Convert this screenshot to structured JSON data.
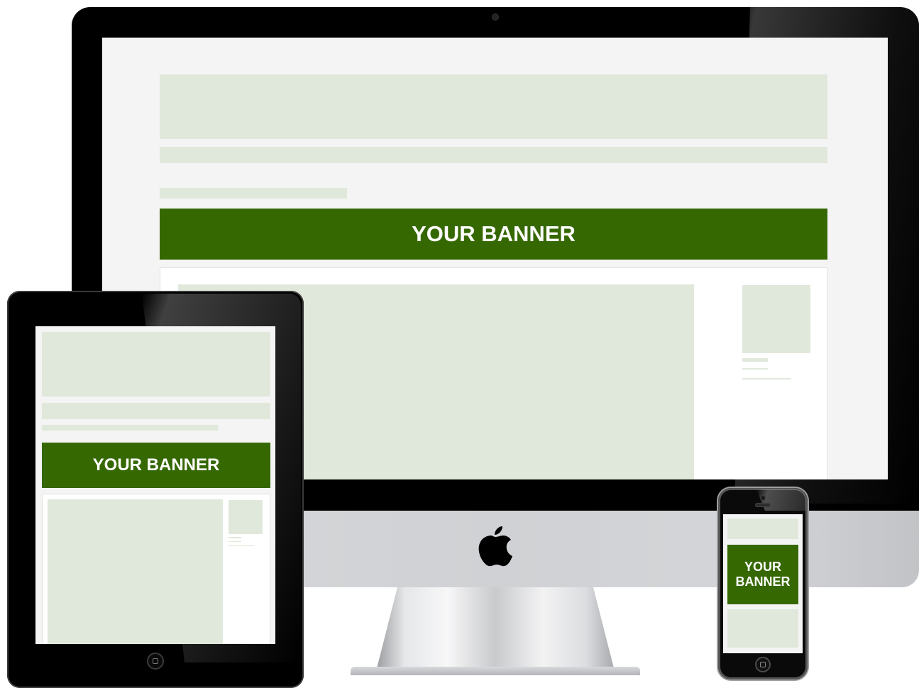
{
  "desktop": {
    "banner_text": "YOUR BANNER"
  },
  "tablet": {
    "banner_text": "YOUR BANNER"
  },
  "phone": {
    "banner_line1": "YOUR",
    "banner_line2": "BANNER"
  },
  "colors": {
    "banner_green": "#366801",
    "placeholder": "#e0e8db",
    "page_bg": "#f4f4f4"
  },
  "icons": [
    "apple-logo-icon",
    "home-button-icon"
  ]
}
